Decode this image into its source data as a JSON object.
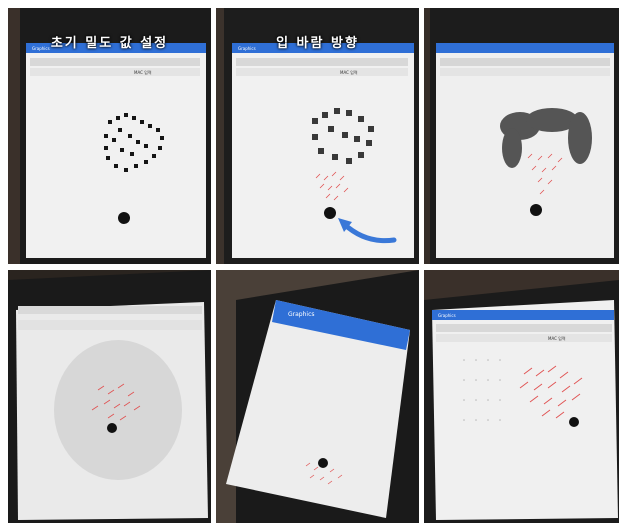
{
  "panels": [
    {
      "caption": "초기 밀도 값 설정",
      "app_title": "Graphics",
      "label": "MAC 입력"
    },
    {
      "caption": "입 바람 방향",
      "app_title": "Graphics",
      "label": "MAC 입력"
    },
    {
      "caption": "",
      "app_title": "",
      "label": ""
    },
    {
      "caption": "",
      "app_title": "",
      "label": ""
    },
    {
      "caption": "",
      "app_title": "Graphics",
      "label": ""
    },
    {
      "caption": "",
      "app_title": "Graphics",
      "label": "MAC 입력"
    }
  ],
  "colors": {
    "app_bar": "#2f6fd6",
    "screen": "#f2f2f2",
    "density": "#1a1a1a",
    "vector": "#e05050",
    "arrow": "#3a78d8"
  },
  "icons": [
    "phone-photo",
    "blue-arrow",
    "black-dot"
  ]
}
